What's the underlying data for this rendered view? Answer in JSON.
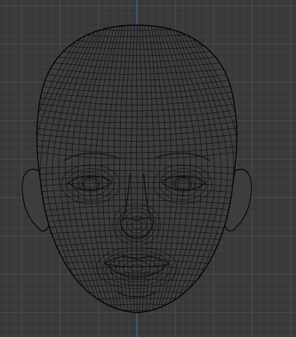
{
  "app": {
    "view": "front-orthographic-viewport",
    "background_color": "#393939",
    "grid": {
      "major_color": "#505050",
      "minor_color": "#444444",
      "axis_color": "#4a6bb0"
    },
    "object": {
      "type": "head-mesh-wireframe",
      "fill_color": "#3d3d3d",
      "wire_color": "#0d0d0d",
      "outline_color": "#000000"
    }
  }
}
